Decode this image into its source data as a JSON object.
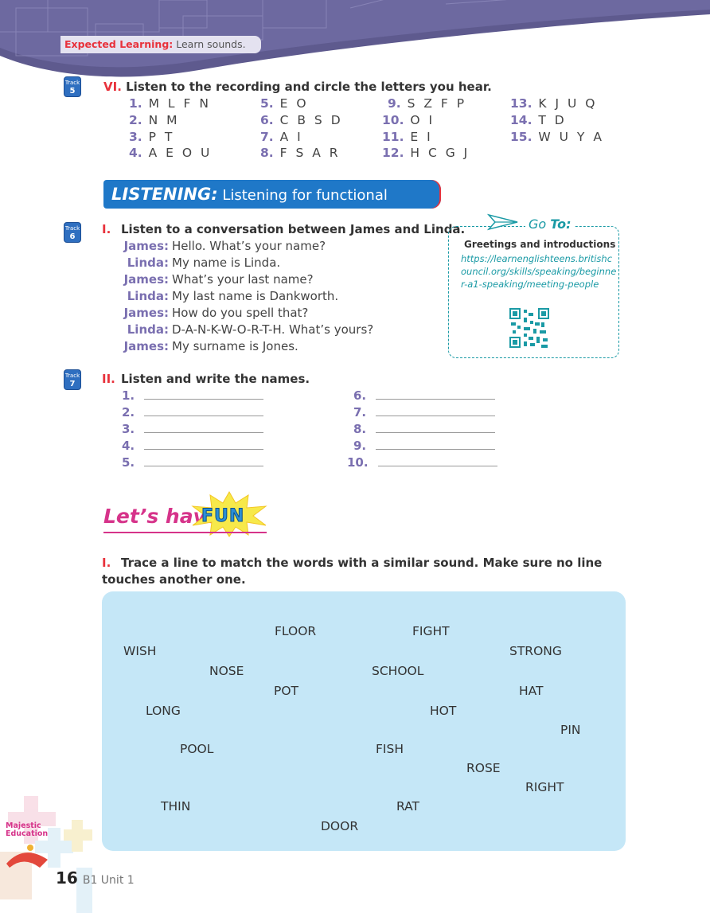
{
  "header": {
    "label": "Expected Learning:",
    "text": "Learn sounds."
  },
  "track_word": "Track",
  "sec_vi": {
    "roman": "VI.",
    "title": "Listen to the recording and circle the letters you hear.",
    "track": "5",
    "items": [
      {
        "n": "1.",
        "t": "M L F N"
      },
      {
        "n": "2.",
        "t": "N M"
      },
      {
        "n": "3.",
        "t": "P T"
      },
      {
        "n": "4.",
        "t": "A E O U"
      },
      {
        "n": "5.",
        "t": "E O"
      },
      {
        "n": "6.",
        "t": "C B S D"
      },
      {
        "n": "7.",
        "t": "A I"
      },
      {
        "n": "8.",
        "t": "F S A R"
      },
      {
        "n": "9.",
        "t": "S Z F P"
      },
      {
        "n": "10.",
        "t": "O I"
      },
      {
        "n": "11.",
        "t": "E I"
      },
      {
        "n": "12.",
        "t": "H C G J"
      },
      {
        "n": "13.",
        "t": "K J U Q"
      },
      {
        "n": "14.",
        "t": "T D"
      },
      {
        "n": "15.",
        "t": "W U Y A"
      }
    ]
  },
  "listening": {
    "bold": "LISTENING:",
    "rest": "Listening for functional language"
  },
  "sec_i": {
    "roman": "I.",
    "title": "Listen to a conversation between James and Linda.",
    "track": "6",
    "lines": [
      {
        "sp": "James:",
        "t": "Hello. What’s your name?"
      },
      {
        "sp": "Linda:",
        "t": "My name is Linda."
      },
      {
        "sp": "James:",
        "t": "What’s your last name?"
      },
      {
        "sp": "Linda:",
        "t": "My last name is Dankworth."
      },
      {
        "sp": "James:",
        "t": "How do you spell that?"
      },
      {
        "sp": "Linda:",
        "t": "D-A-N-K-W-O-R-T-H. What’s yours?"
      },
      {
        "sp": "James:",
        "t": "My surname is Jones."
      }
    ]
  },
  "goto": {
    "head_a": "Go",
    "head_b": "To:",
    "title": "Greetings and introductions",
    "url": "https://learnenglishteens.britishcouncil.org/skills/speaking/beginner-a1-speaking/meeting-people"
  },
  "sec_ii": {
    "roman": "II.",
    "title": "Listen and write the names.",
    "track": "7",
    "nums": [
      "1.",
      "2.",
      "3.",
      "4.",
      "5.",
      "6.",
      "7.",
      "8.",
      "9.",
      "10."
    ]
  },
  "fun": {
    "text": "Let’s have",
    "badge": "FUN"
  },
  "match": {
    "roman": "I.",
    "instruction": "Trace a line to match the words with a similar sound. Make sure no line touches another one.",
    "words": [
      "FLOOR",
      "FIGHT",
      "WISH",
      "STRONG",
      "NOSE",
      "SCHOOL",
      "POT",
      "HAT",
      "LONG",
      "HOT",
      "PIN",
      "POOL",
      "FISH",
      "ROSE",
      "RIGHT",
      "THIN",
      "RAT",
      "DOOR"
    ]
  },
  "footer": {
    "page": "16",
    "unit": "B1 Unit 1",
    "brand1": "Majestic",
    "brand2": "Education"
  },
  "colors": {
    "accent_red": "#e8323c",
    "purple": "#7a6fb0",
    "blue": "#1f78c8",
    "teal": "#1a9aa5",
    "board": "#c5e7f7",
    "pink": "#d6338a"
  }
}
